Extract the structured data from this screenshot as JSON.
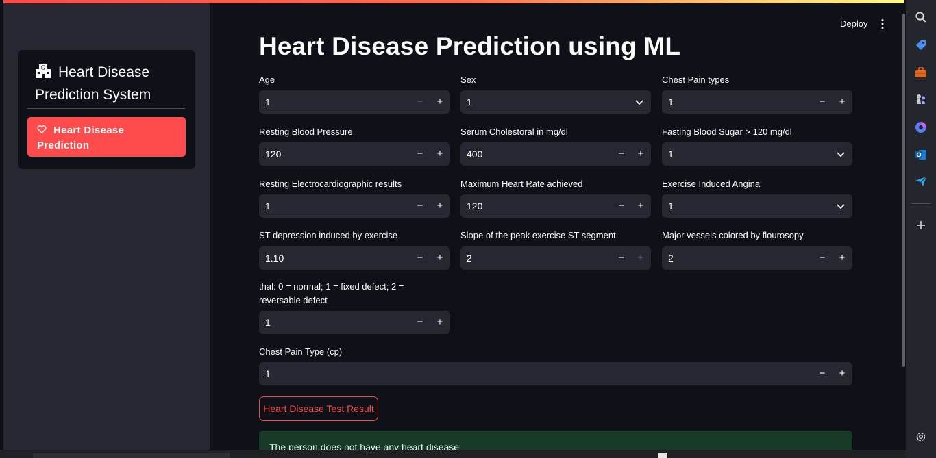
{
  "sidebar": {
    "title": "Heart Disease Prediction System",
    "nav_button": "Heart Disease Prediction"
  },
  "header": {
    "deploy_label": "Deploy"
  },
  "main": {
    "title": "Heart Disease Prediction using ML",
    "fields": {
      "age": {
        "label": "Age",
        "value": "1"
      },
      "sex": {
        "label": "Sex",
        "value": "1"
      },
      "chest_pain_types": {
        "label": "Chest Pain types",
        "value": "1"
      },
      "resting_bp": {
        "label": "Resting Blood Pressure",
        "value": "120"
      },
      "serum_chol": {
        "label": "Serum Cholestoral in mg/dl",
        "value": "400"
      },
      "fasting_bs": {
        "label": "Fasting Blood Sugar > 120 mg/dl",
        "value": "1"
      },
      "resting_ecg": {
        "label": "Resting Electrocardiographic results",
        "value": "1"
      },
      "max_hr": {
        "label": "Maximum Heart Rate achieved",
        "value": "120"
      },
      "exercise_angina": {
        "label": "Exercise Induced Angina",
        "value": "1"
      },
      "st_depression": {
        "label": "ST depression induced by exercise",
        "value": "1.10"
      },
      "slope": {
        "label": "Slope of the peak exercise ST segment",
        "value": "2"
      },
      "major_vessels": {
        "label": "Major vessels colored by flourosopy",
        "value": "2"
      },
      "thal": {
        "label": "thal: 0 = normal; 1 = fixed defect; 2 = reversable defect",
        "value": "1"
      },
      "cp": {
        "label": "Chest Pain Type (cp)",
        "value": "1"
      }
    },
    "stepper": {
      "minus": "−",
      "plus": "+"
    },
    "result_button": "Heart Disease Test Result",
    "result_message": "The person does not have any heart disease"
  },
  "icons": {
    "sidebar_title": "hospital-icon",
    "nav": "heart-icon",
    "rail": [
      "search-icon",
      "tag-icon",
      "briefcase-icon",
      "chess-icon",
      "copilot-icon",
      "outlook-icon",
      "send-icon",
      "add-icon",
      "settings-icon"
    ]
  },
  "colors": {
    "accent": "#ff4b4b",
    "background": "#0e1117",
    "sidebar": "#262730",
    "input": "#262730",
    "success_bg": "#173928"
  }
}
